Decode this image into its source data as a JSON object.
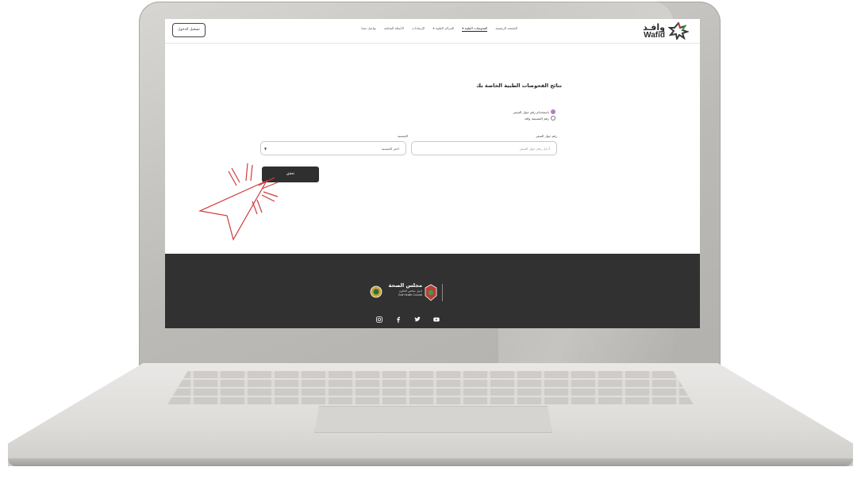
{
  "nav": {
    "login_label": "تسجيل الدخول",
    "links": [
      {
        "label": "الصفحة الرئيسية",
        "active": false
      },
      {
        "label": "الفحوصات الطبية ▾",
        "active": true
      },
      {
        "label": "المراكز الطبية ▾",
        "active": false
      },
      {
        "label": "الإرشادات",
        "active": false
      },
      {
        "label": "الأسئلة الشائعة",
        "active": false
      },
      {
        "label": "تواصل معنا",
        "active": false
      }
    ],
    "logo_ar": "وافـد",
    "logo_en": "Wafid"
  },
  "main": {
    "title": "نتائج الفحوصات الطبية الخاصة بك",
    "radio_options": [
      {
        "label": "باستخدام رقم جواز السفر",
        "checked": true
      },
      {
        "label": "رقم القسيمة وافد",
        "checked": false
      }
    ],
    "passport_label": "رقم جواز السفر",
    "passport_placeholder": "أدخل رقم جواز السفر",
    "nationality_label": "الجنسية",
    "nationality_value": "اختر الجنسية",
    "check_button": "تحقق"
  },
  "footer": {
    "council_ar": "مجلس الصحة",
    "council_ar_sub": "لدول مجلس التعاون",
    "council_en": "Gulf Health Council",
    "social_icons": [
      "instagram-icon",
      "facebook-icon",
      "twitter-icon",
      "youtube-icon"
    ]
  },
  "colors": {
    "footer_bg": "#313131",
    "button_bg": "#2f2f2f",
    "radio_accent": "#b57cc8",
    "click_accent": "#d13b3b"
  }
}
